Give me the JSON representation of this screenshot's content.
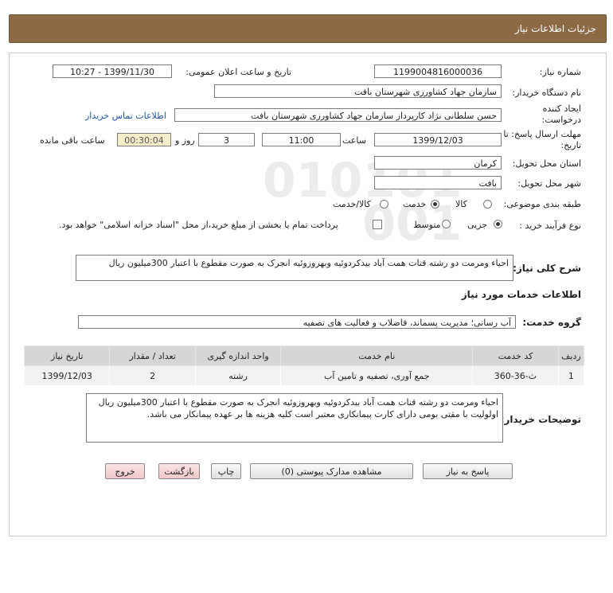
{
  "header": {
    "title": "جزئیات اطلاعات نیاز"
  },
  "labels": {
    "need_number": "شماره نیاز:",
    "announce_datetime": "تاریخ و ساعت اعلان عمومی:",
    "buyer_org": "نام دستگاه خریدار:",
    "requester": "ایجاد کننده درخواست:",
    "deadline": "مهلت ارسال پاسخ: تا تاریخ:",
    "time_word": "ساعت",
    "day_word": "روز و",
    "remaining": "ساعت باقی مانده",
    "province": "استان محل تحویل:",
    "city": "شهر محل تحویل:",
    "category": "طبقه بندی موضوعی:",
    "purchase_type": "نوع فرآیند خرید :",
    "description": "شرح کلی نیاز:",
    "services_info": "اطلاعات خدمات مورد نیاز",
    "service_group": "گروه خدمت:",
    "buyer_notes": "توضیحات خریدار:"
  },
  "values": {
    "need_number": "1199004816000036",
    "announce_datetime": "1399/11/30 - 10:27",
    "buyer_org": "سازمان جهاد کشاورزی شهرستان بافت",
    "requester": "حسن سلطانی نژاد کارپرداز سازمان جهاد کشاورزی شهرستان بافت",
    "contact_link": "اطلاعات تماس خریدار",
    "deadline_date": "1399/12/03",
    "deadline_time": "11:00",
    "days": "3",
    "remaining_time": "00:30:04",
    "province": "کرمان",
    "city": "بافت",
    "description": "احیاء ومرمت دو رشته قنات همت آباد بیدکردوئیه وبهروزوئیه انجرک به صورت مقطوع با اعتبار 300میلیون ریال",
    "service_group": "آب رسانی؛ مدیریت پسماند، فاضلاب و فعالیت های تصفیه",
    "buyer_notes": "احیاء ومرمت دو رشته قنات همت آباد بیدکردوئیه وبهروزوئیه انجرک به صورت مقطوع با اعتبار 300میلیون ریال اولولیت با مقتی بومی دارای کارت پیمانکاری معتبر است کلیه هزینه ها بر عهده پیمانکار می باشد."
  },
  "category_options": [
    {
      "label": "کالا",
      "selected": false
    },
    {
      "label": "خدمت",
      "selected": true
    },
    {
      "label": "کالا/خدمت",
      "selected": false
    }
  ],
  "purchase_options": [
    {
      "label": "جزیی",
      "selected": true
    },
    {
      "label": "متوسط",
      "selected": false
    }
  ],
  "payment_note": "پرداخت تمام یا بخشی از مبلغ خرید،از محل \"اسناد خزانه اسلامی\" خواهد بود.",
  "table": {
    "headers": [
      "ردیف",
      "کد خدمت",
      "نام خدمت",
      "واحد اندازه گیری",
      "تعداد / مقدار",
      "تاریخ نیاز"
    ],
    "rows": [
      [
        "1",
        "ث-36-360",
        "جمع آوری، تصفیه و تامین آب",
        "رشته",
        "2",
        "1399/12/03"
      ]
    ]
  },
  "buttons": {
    "reply": "پاسخ به نیاز",
    "attachments": "مشاهده مدارک پیوستی (0)",
    "print": "چاپ",
    "back": "بازگشت",
    "exit": "خروج"
  }
}
